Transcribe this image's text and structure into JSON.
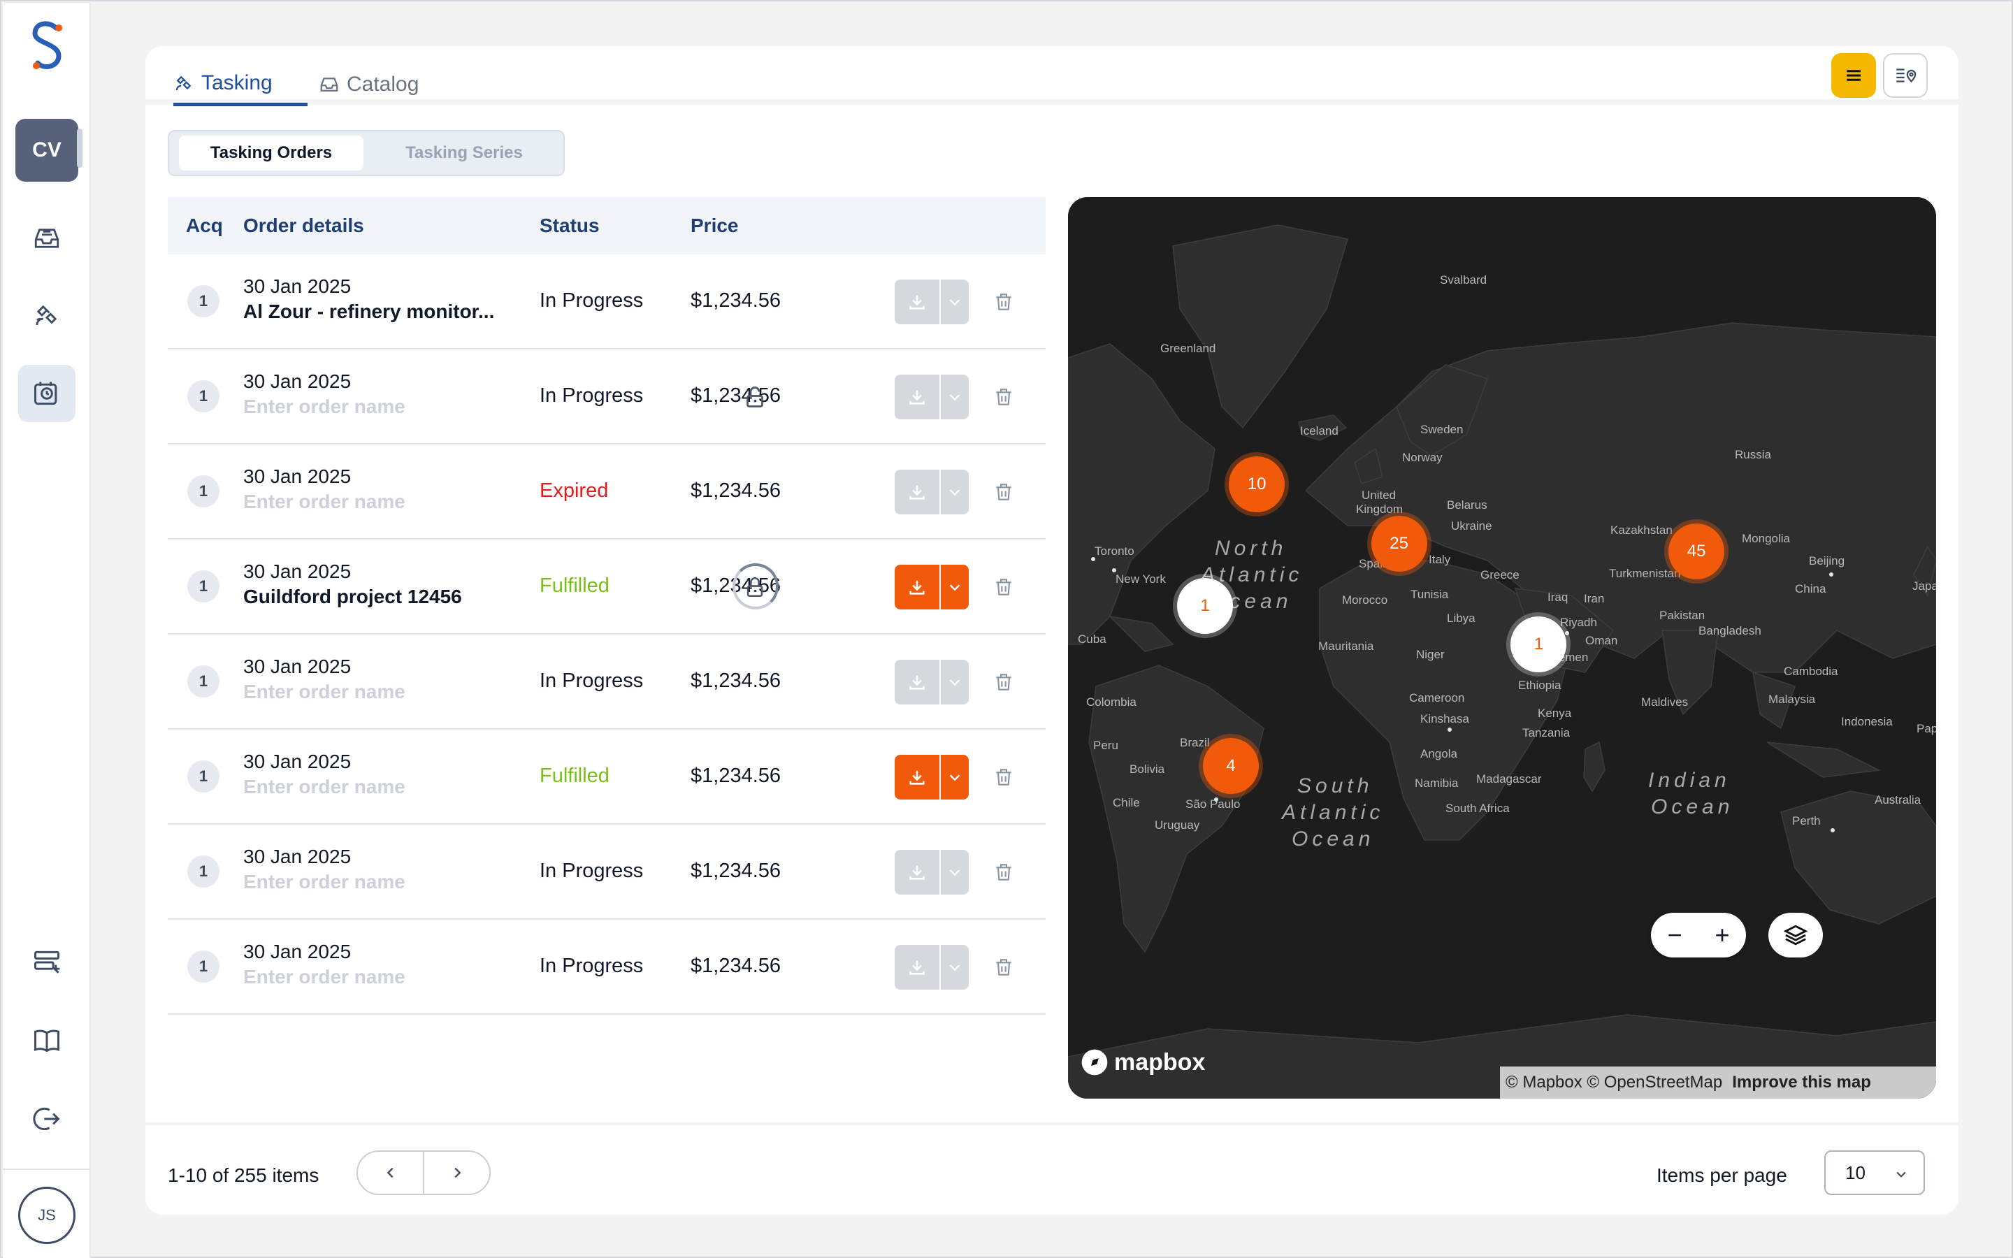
{
  "sidebar": {
    "logo": "S",
    "workspace_badge": "CV",
    "items": [
      {
        "icon": "inbox-icon",
        "active": false
      },
      {
        "icon": "satellite-icon",
        "active": false
      },
      {
        "icon": "clock-board-icon",
        "active": true
      }
    ],
    "bottom_items": [
      {
        "icon": "settings-list-icon"
      },
      {
        "icon": "book-icon"
      },
      {
        "icon": "logout-icon"
      }
    ],
    "user_initials": "JS"
  },
  "tabs": [
    {
      "label": "Tasking",
      "active": true,
      "icon": "satellite-icon"
    },
    {
      "label": "Catalog",
      "active": false,
      "icon": "tray-icon"
    }
  ],
  "toolbar": {
    "list_view_icon": "list-icon",
    "map_view_icon": "map-pin-list-icon"
  },
  "segment": {
    "options": [
      "Tasking Orders",
      "Tasking Series"
    ],
    "selected": "Tasking Orders"
  },
  "table": {
    "columns": [
      "Acq",
      "Order details",
      "Status",
      "Price"
    ],
    "rows": [
      {
        "acq": "1",
        "date": "30 Jan 2025",
        "name": "Al Zour - refinery monitor...",
        "placeholder": false,
        "status": "In Progress",
        "status_kind": "progress",
        "price": "$1,234.56",
        "lock": "none",
        "download_enabled": false
      },
      {
        "acq": "1",
        "date": "30 Jan 2025",
        "name": "Enter order name",
        "placeholder": true,
        "status": "In Progress",
        "status_kind": "progress",
        "price": "$1,234.56",
        "lock": "unlocked",
        "download_enabled": false
      },
      {
        "acq": "1",
        "date": "30 Jan 2025",
        "name": "Enter order name",
        "placeholder": true,
        "status": "Expired",
        "status_kind": "expired",
        "price": "$1,234.56",
        "lock": "none",
        "download_enabled": false
      },
      {
        "acq": "1",
        "date": "30 Jan 2025",
        "name": "Guildford project 12456",
        "placeholder": false,
        "status": "Fulfilled",
        "status_kind": "fulfilled",
        "price": "$1,234.56",
        "lock": "locked-progress",
        "download_enabled": true
      },
      {
        "acq": "1",
        "date": "30 Jan 2025",
        "name": "Enter order name",
        "placeholder": true,
        "status": "In Progress",
        "status_kind": "progress",
        "price": "$1,234.56",
        "lock": "none",
        "download_enabled": false
      },
      {
        "acq": "1",
        "date": "30 Jan 2025",
        "name": "Enter order name",
        "placeholder": true,
        "status": "Fulfilled",
        "status_kind": "fulfilled",
        "price": "$1,234.56",
        "lock": "none",
        "download_enabled": true
      },
      {
        "acq": "1",
        "date": "30 Jan 2025",
        "name": "Enter order name",
        "placeholder": true,
        "status": "In Progress",
        "status_kind": "progress",
        "price": "$1,234.56",
        "lock": "none",
        "download_enabled": false
      },
      {
        "acq": "1",
        "date": "30 Jan 2025",
        "name": "Enter order name",
        "placeholder": true,
        "status": "In Progress",
        "status_kind": "progress",
        "price": "$1,234.56",
        "lock": "none",
        "download_enabled": false
      }
    ]
  },
  "map": {
    "labels": [
      "Greenland",
      "Svalbard",
      "Iceland",
      "Sweden",
      "Norway",
      "Russia",
      "United Kingdom",
      "Belarus",
      "Ukraine",
      "Kazakhstan",
      "Mongolia",
      "Beijing",
      "China",
      "Japan",
      "Toronto",
      "New York",
      "North Atlantic Ocean",
      "Spain",
      "Italy",
      "Greece",
      "Turkmenistan",
      "Morocco",
      "Tunisia",
      "Libya",
      "Iraq",
      "Iran",
      "Pakistan",
      "Bangladesh",
      "Cuba",
      "Mauritania",
      "Niger",
      "Riyadh",
      "Oman",
      "Yemen",
      "Ethiopia",
      "Cameroon",
      "Kenya",
      "Kinshasa",
      "Tanzania",
      "Angola",
      "Namibia",
      "Madagascar",
      "South Africa",
      "Colombia",
      "Peru",
      "Bolivia",
      "Brazil",
      "Chile",
      "São Paulo",
      "Uruguay",
      "South Atlantic Ocean",
      "Indian Ocean",
      "Maldives",
      "Cambodia",
      "Malaysia",
      "Indonesia",
      "Australia",
      "Perth",
      "Papua"
    ],
    "clusters": [
      {
        "count": "10",
        "style": "orange"
      },
      {
        "count": "25",
        "style": "orange"
      },
      {
        "count": "45",
        "style": "orange"
      },
      {
        "count": "1",
        "style": "white"
      },
      {
        "count": "1",
        "style": "white"
      },
      {
        "count": "4",
        "style": "orange"
      }
    ],
    "zoom_out": "−",
    "zoom_in": "+",
    "brand": "mapbox",
    "attribution": "© Mapbox © OpenStreetMap",
    "improve_link": "Improve this map"
  },
  "pagination": {
    "summary": "1-10 of 255 items",
    "items_per_page_label": "Items per page",
    "items_per_page": "10"
  },
  "colors": {
    "accent": "#1f4f9c",
    "orange": "#f15a0a",
    "yellow": "#f5b800",
    "expired": "#e21d1d",
    "fulfilled": "#79bf17"
  }
}
